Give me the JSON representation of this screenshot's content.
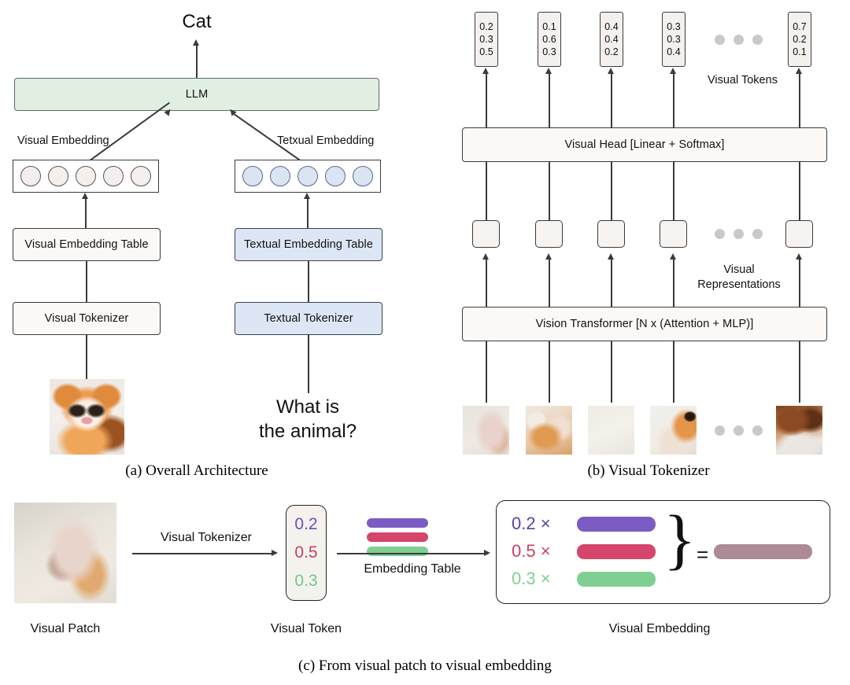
{
  "figure": {
    "panels": [
      {
        "id": "a",
        "caption": "(a) Overall Architecture"
      },
      {
        "id": "b",
        "caption": "(b) Visual Tokenizer"
      },
      {
        "id": "c",
        "caption": "(c) From visual patch to visual embedding"
      }
    ]
  },
  "panel_a": {
    "output_text": "Cat",
    "llm_label": "LLM",
    "visual_embedding_label": "Visual Embedding",
    "textual_embedding_label": "Tetxual Embedding",
    "visual_embedding_table": "Visual Embedding Table",
    "textual_embedding_table": "Textual Embedding Table",
    "visual_tokenizer": "Visual Tokenizer",
    "textual_tokenizer": "Textual Tokenizer",
    "question_line1": "What is",
    "question_line2": "the animal?",
    "image_alt": "orange-cat-photo",
    "visual_circle_count": 5,
    "textual_circle_count": 5
  },
  "panel_b": {
    "visual_tokens_label": "Visual Tokens",
    "visual_representations_label_line1": "Visual",
    "visual_representations_label_line2": "Representations",
    "visual_head_label": "Visual Head [Linear + Softmax]",
    "vision_transformer_label": "Vision Transformer [N x (Attention + MLP)]",
    "tokens": [
      {
        "values": [
          "0.2",
          "0.3",
          "0.5"
        ]
      },
      {
        "values": [
          "0.1",
          "0.6",
          "0.3"
        ]
      },
      {
        "values": [
          "0.4",
          "0.4",
          "0.2"
        ]
      },
      {
        "values": [
          "0.3",
          "0.3",
          "0.4"
        ]
      },
      {
        "values": [
          "0.7",
          "0.2",
          "0.1"
        ]
      }
    ],
    "patch_alts": [
      "patch-1",
      "patch-2",
      "patch-3",
      "patch-4",
      "patch-5"
    ]
  },
  "panel_c": {
    "visual_patch_label": "Visual Patch",
    "visual_token_label": "Visual Token",
    "visual_embedding_label": "Visual Embedding",
    "visual_tokenizer_label": "Visual Tokenizer",
    "embedding_table_label": "Embedding Table",
    "equals_sign": "=",
    "token_values": [
      "0.2",
      "0.5",
      "0.3"
    ],
    "terms": [
      {
        "coefficient": "0.2 ×",
        "color": "#7b5cc4"
      },
      {
        "coefficient": "0.5 ×",
        "color": "#d6456b"
      },
      {
        "coefficient": "0.3 ×",
        "color": "#7fcf93"
      }
    ],
    "result_color": "#ad8a96",
    "patch_alt": "visual-patch-photo"
  },
  "colors": {
    "visual_fill": "#faf6f4",
    "textual_fill": "#dde6f5",
    "llm_fill": "#e1efe3",
    "purple": "#7b5cc4",
    "red": "#d6456b",
    "green": "#7fcf93",
    "mauve": "#ad8a96",
    "stroke": "#3b3b3b"
  }
}
